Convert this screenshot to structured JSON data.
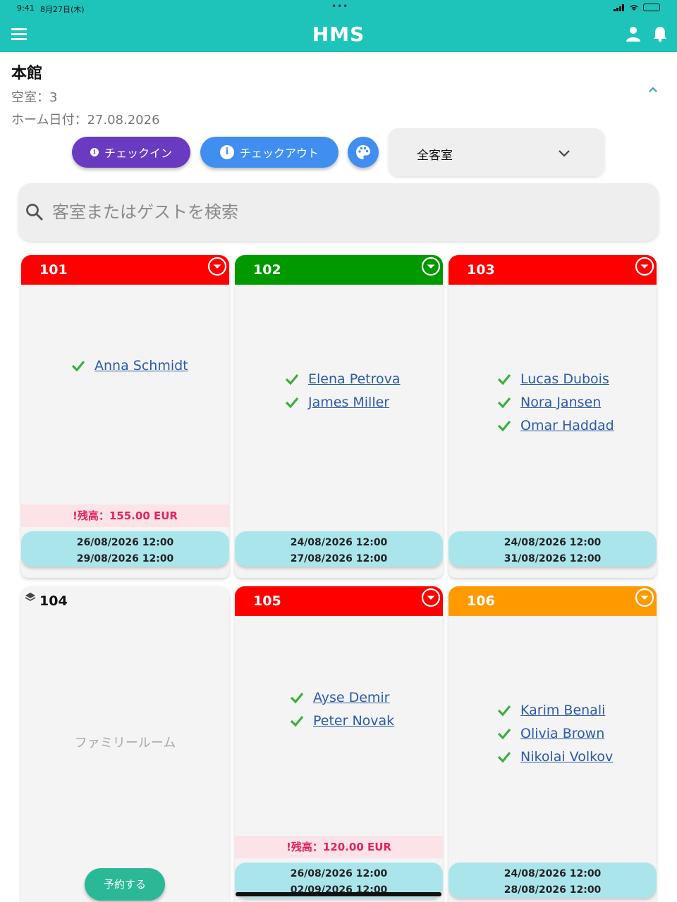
{
  "statusbar": {
    "time": "9:41",
    "date": "8月27日(木)"
  },
  "app": {
    "title": "HMS"
  },
  "header": {
    "building": "本館",
    "vacancy": "空室：3",
    "home_date": "ホーム日付：27.08.2026"
  },
  "toolbar": {
    "checkin_label": "チェックイン",
    "checkout_label": "チェックアウト",
    "room_filter": "全客室"
  },
  "search": {
    "placeholder": "客室またはゲストを検索"
  },
  "colors": {
    "accent": "#1ec4b9",
    "occupied": "#ff0000",
    "free": "#009900",
    "warning": "#ff9900"
  },
  "rooms": [
    {
      "number": "101",
      "color": "#ff0000",
      "guests": [
        "Anna Schmidt"
      ],
      "balance": "!残高：155.00 EUR",
      "checkin": "26/08/2026 12:00",
      "checkout": "29/08/2026 12:00"
    },
    {
      "number": "102",
      "color": "#009900",
      "guests": [
        "Elena Petrova",
        "James Miller"
      ],
      "checkin": "24/08/2026 12:00",
      "checkout": "27/08/2026 12:00"
    },
    {
      "number": "103",
      "color": "#ff0000",
      "guests": [
        "Lucas Dubois",
        "Nora Jansen",
        "Omar Haddad"
      ],
      "checkin": "24/08/2026 12:00",
      "checkout": "31/08/2026 12:00"
    },
    {
      "number": "104",
      "room_type": "ファミリールーム",
      "reserve_label": "予約する"
    },
    {
      "number": "105",
      "color": "#ff0000",
      "guests": [
        "Ayse Demir",
        "Peter Novak"
      ],
      "balance": "!残高：120.00 EUR",
      "checkin": "26/08/2026 12:00",
      "checkout": "02/09/2026 12:00"
    },
    {
      "number": "106",
      "color": "#ff9900",
      "guests": [
        "Karim Benali",
        "Olivia Brown",
        "Nikolai Volkov"
      ],
      "checkin": "24/08/2026 12:00",
      "checkout": "28/08/2026 12:00"
    }
  ]
}
